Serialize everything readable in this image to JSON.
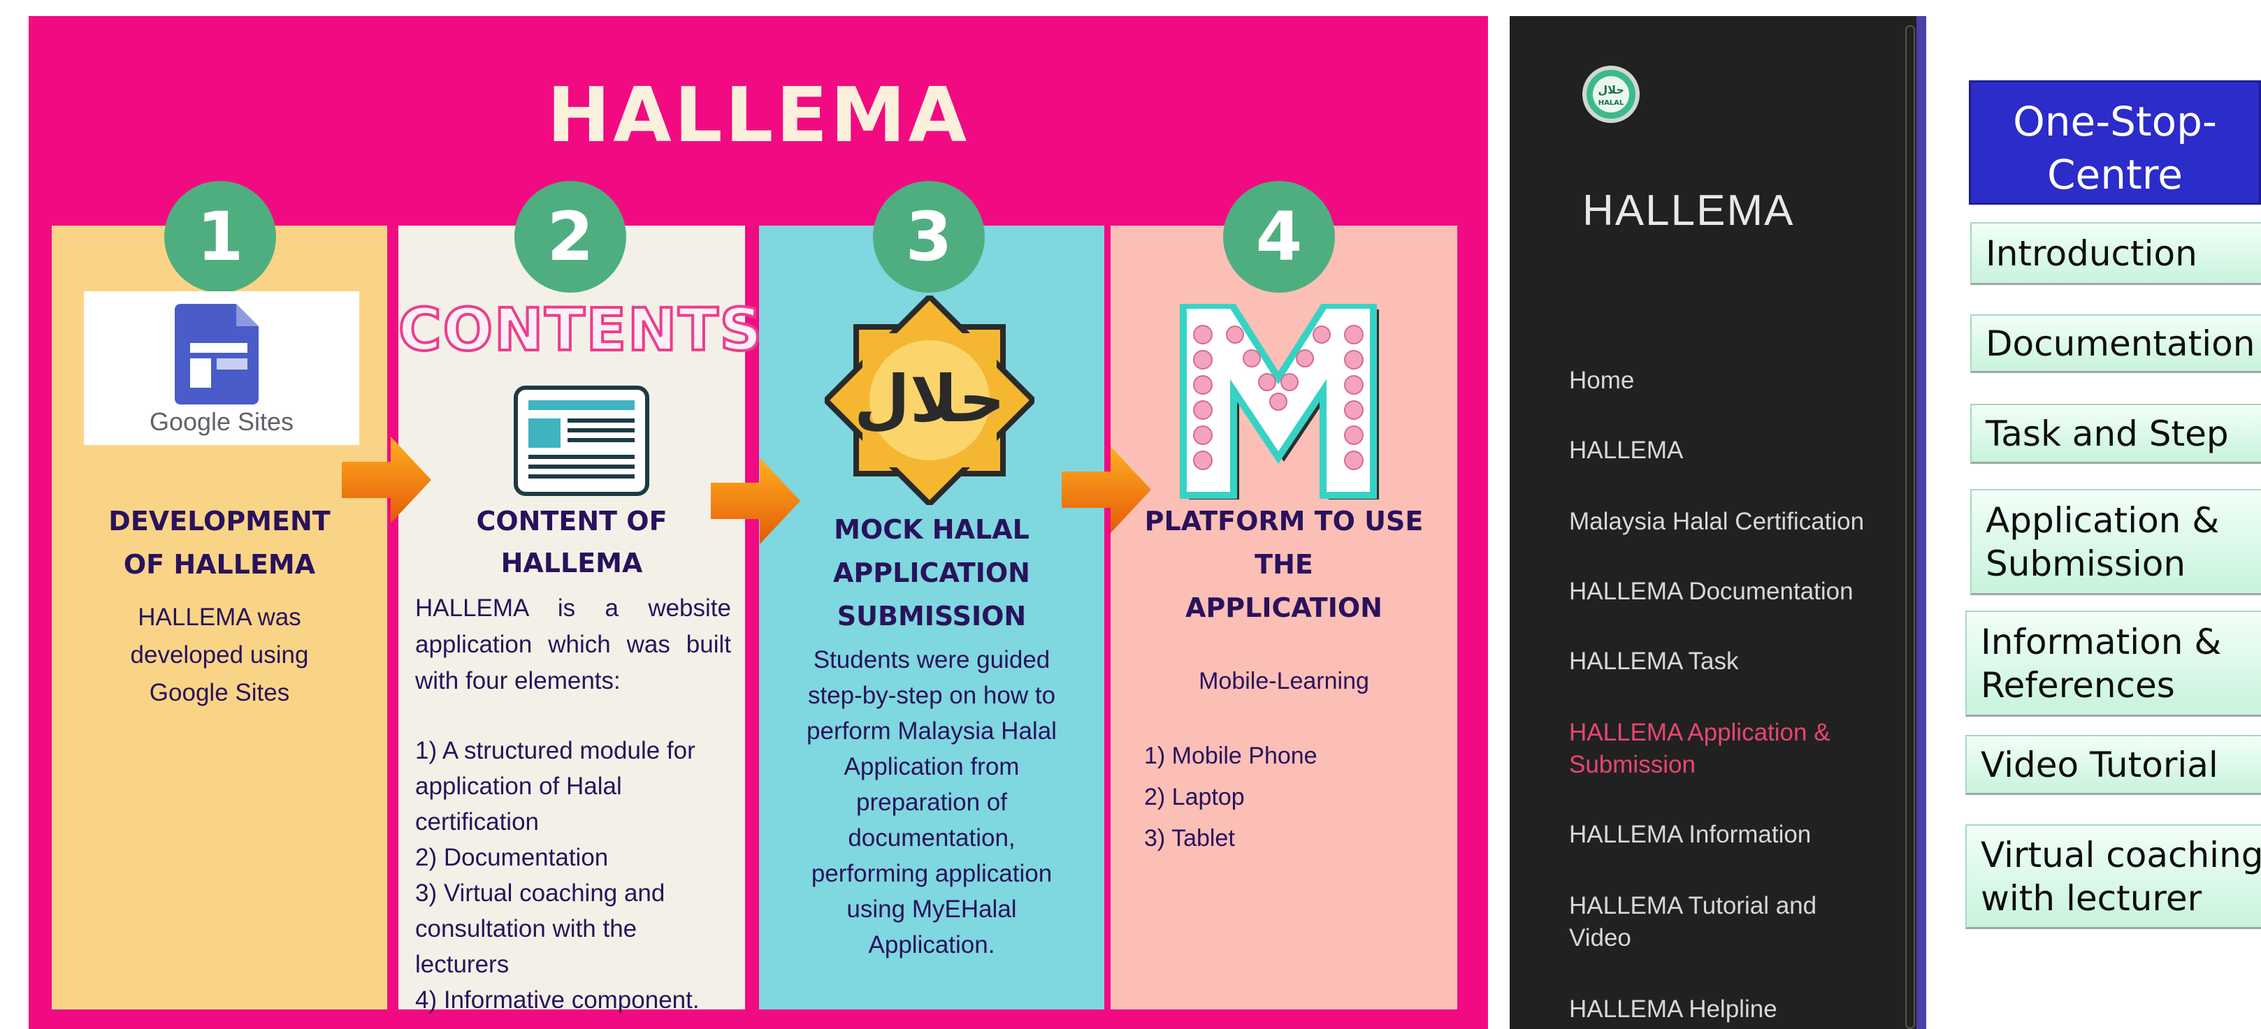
{
  "poster": {
    "title": "HALLEMA",
    "columns": [
      {
        "number": "1",
        "image_caption": "Google Sites",
        "title_line1": "DEVELOPMENT",
        "title_line2": "OF HALLEMA",
        "body": [
          "HALLEMA was",
          "developed using",
          "Google Sites"
        ]
      },
      {
        "number": "2",
        "banner": "CONTENTS",
        "title_line1": "CONTENT OF",
        "title_line2": "HALLEMA",
        "intro": [
          "HALLEMA is a website",
          "application which was built",
          "with four elements:"
        ],
        "items": [
          "1) A structured module for",
          "application of Halal",
          "certification",
          "2) Documentation",
          "3) Virtual coaching and",
          "consultation with the",
          "lecturers",
          "4) Informative component."
        ]
      },
      {
        "number": "3",
        "title_line1": "MOCK HALAL",
        "title_line2": "APPLICATION",
        "title_line3": "SUBMISSION",
        "body": [
          "Students were guided",
          "step-by-step on how to",
          "perform Malaysia Halal",
          "Application from",
          "preparation of",
          "documentation,",
          "performing application",
          "using MyEHalal",
          "Application."
        ]
      },
      {
        "number": "4",
        "title_line1": "PLATFORM TO USE",
        "title_line2": "THE",
        "title_line3": "APPLICATION",
        "subtitle": "Mobile-Learning",
        "items": [
          "1) Mobile Phone",
          "2) Laptop",
          "3) Tablet"
        ]
      }
    ]
  },
  "sidebar": {
    "brand": "HALLEMA",
    "items": [
      {
        "label": "Home"
      },
      {
        "label": "HALLEMA"
      },
      {
        "label": "Malaysia Halal Certification"
      },
      {
        "label": "HALLEMA Documentation"
      },
      {
        "label": "HALLEMA Task"
      },
      {
        "label": "HALLEMA Application & Submission",
        "active": true
      },
      {
        "label": "HALLEMA Information"
      },
      {
        "label": "HALLEMA Tutorial and Video"
      },
      {
        "label": "HALLEMA Helpline"
      }
    ],
    "active_color": "#e8466f"
  },
  "right_nav": {
    "header": "One-Stop-Centre",
    "buttons": [
      {
        "label": "Introduction"
      },
      {
        "label": "Documentation"
      },
      {
        "label": "Task and Step"
      },
      {
        "label": "Application & Submission"
      },
      {
        "label": "Information & References"
      },
      {
        "label": "Video Tutorial"
      },
      {
        "label": "Virtual coaching with lecturer"
      }
    ]
  },
  "colors": {
    "poster_bg": "#f20a82",
    "col1": "#fad486",
    "col2": "#f3f1e7",
    "col3": "#7fd7df",
    "col4": "#fcbfb6",
    "step_circle": "#4fae7f",
    "title_text": "#29125c",
    "one_stop_header": "#2b2cc9"
  }
}
